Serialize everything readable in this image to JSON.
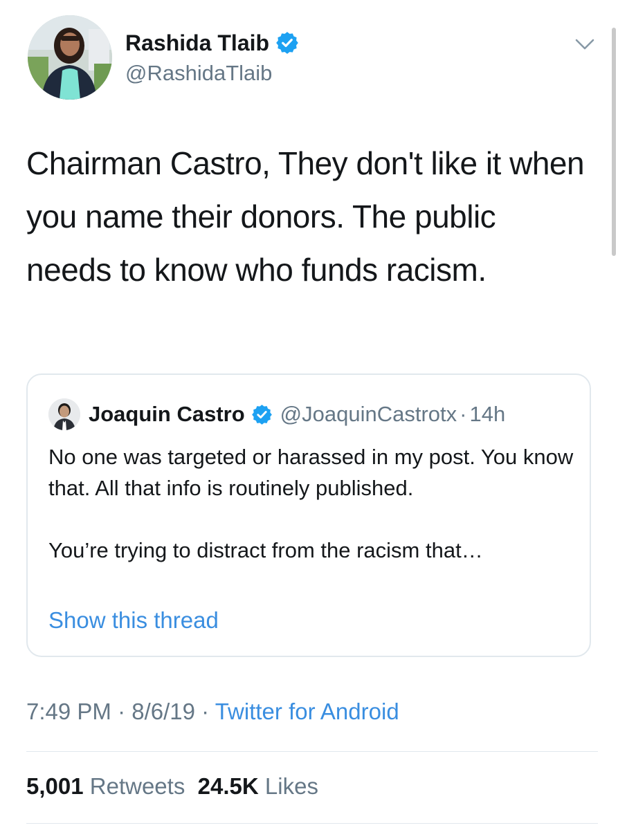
{
  "tweet": {
    "author": {
      "name": "Rashida Tlaib",
      "handle": "@RashidaTlaib"
    },
    "text": "Chairman Castro, They don't like it when you name their donors. The public needs to know who funds racism.",
    "quoted": {
      "name": "Joaquin Castro",
      "handle": "@JoaquinCastrotx",
      "separator": "·",
      "time": "14h",
      "paragraph1": "No one was targeted or harassed in my post. You know that. All that info is routinely published.",
      "paragraph2": "You’re trying to distract from the racism that…",
      "show_thread": "Show this thread"
    },
    "meta": {
      "time": "7:49 PM",
      "sep1": " · ",
      "date": "8/6/19",
      "sep2": " · ",
      "source": "Twitter for Android"
    },
    "stats": {
      "retweets_count": "5,001",
      "retweets_label": "Retweets",
      "likes_count": "24.5K",
      "likes_label": "Likes"
    }
  },
  "colors": {
    "verified": "#1da1f2",
    "link": "#3a8ee0",
    "secondary_text": "#657786",
    "border": "#e1e8ed"
  },
  "icons": {
    "verified": "verified-badge-icon",
    "menu": "chevron-down-icon"
  }
}
